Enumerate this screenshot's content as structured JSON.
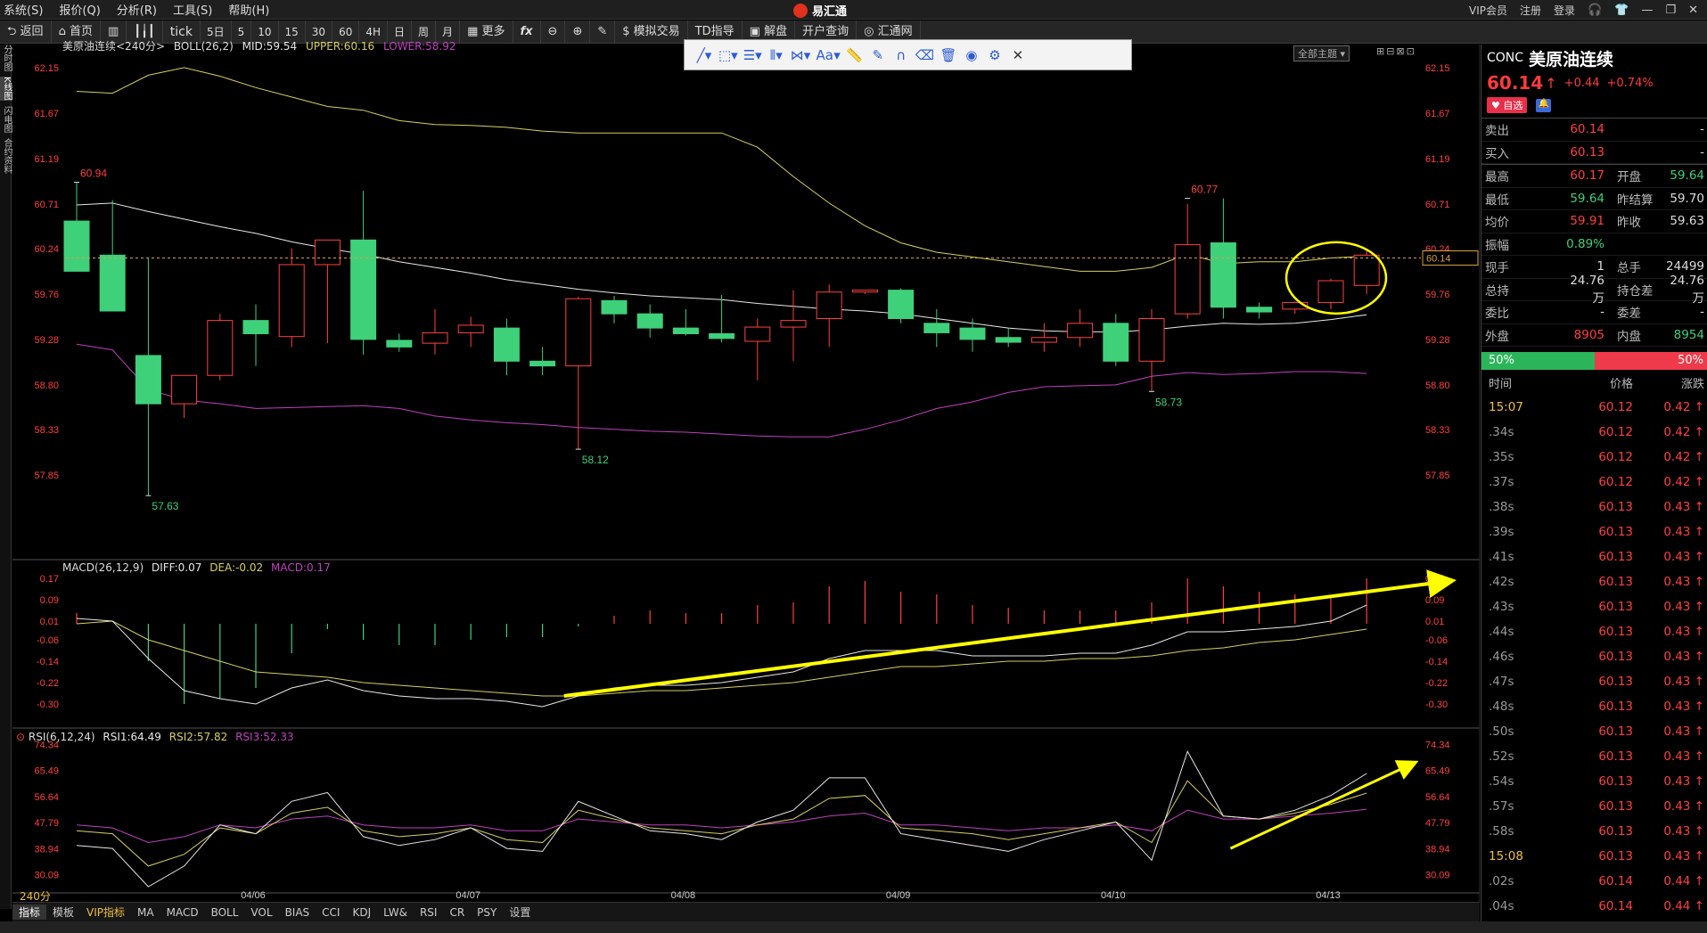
{
  "menu": [
    "系统(S)",
    "报价(Q)",
    "分析(R)",
    "工具(S)",
    "帮助(H)"
  ],
  "app_title": "易汇通",
  "topright": [
    "VIP会员",
    "注册",
    "登录"
  ],
  "toolbar": [
    "返回",
    "首页",
    "tick",
    "5日",
    "5",
    "10",
    "15",
    "30",
    "60",
    "4H",
    "日",
    "周",
    "月",
    "更多",
    "fx",
    "模拟交易",
    "TD指导",
    "解盘",
    "开户查询",
    "汇通网"
  ],
  "drawbar_icons": [
    "line-tool-icon",
    "rect-tool-icon",
    "channel-tool-icon",
    "fib-tool-icon",
    "pattern-tool-icon",
    "text-tool-icon",
    "ruler-icon",
    "pen-icon",
    "magnet-icon",
    "eraser-icon",
    "trash-icon",
    "eye-icon",
    "gear-icon",
    "close-icon"
  ],
  "drawbar_text": "Aa",
  "side_tabs": [
    "分时图",
    "K线图",
    "闪电图",
    "合约资料"
  ],
  "theme_button": "全部主题",
  "chart_data": [
    {
      "type": "candlestick",
      "title": "美原油连续<240分>",
      "indicator": "BOLL(26,2)",
      "legend": {
        "mid": "MID:59.54",
        "upper": "UPPER:60.16",
        "lower": "LOWER:58.92"
      },
      "ylim": [
        57.5,
        62.3
      ],
      "yticks": [
        "62.15",
        "61.67",
        "61.19",
        "60.71",
        "60.24",
        "59.76",
        "59.28",
        "58.80",
        "58.33",
        "57.85"
      ],
      "x_labels": [
        {
          "at": 5,
          "label": "04/06"
        },
        {
          "at": 11,
          "label": "04/07"
        },
        {
          "at": 17,
          "label": "04/08"
        },
        {
          "at": 23,
          "label": "04/09"
        },
        {
          "at": 29,
          "label": "04/10"
        },
        {
          "at": 35,
          "label": "04/13"
        }
      ],
      "candles": [
        [
          60.53,
          60.94,
          60.14,
          60.0
        ],
        [
          60.17,
          60.75,
          60.08,
          59.58
        ],
        [
          59.11,
          60.14,
          57.63,
          58.6
        ],
        [
          58.6,
          58.75,
          58.45,
          58.9
        ],
        [
          58.9,
          59.55,
          58.85,
          59.48
        ],
        [
          59.48,
          59.65,
          59.0,
          59.34
        ],
        [
          59.31,
          60.24,
          59.2,
          60.07
        ],
        [
          60.07,
          60.32,
          59.24,
          60.33
        ],
        [
          60.33,
          60.85,
          59.12,
          59.28
        ],
        [
          59.27,
          59.34,
          59.15,
          59.2
        ],
        [
          59.24,
          59.6,
          59.12,
          59.35
        ],
        [
          59.35,
          59.52,
          59.2,
          59.43
        ],
        [
          59.4,
          59.5,
          58.9,
          59.05
        ],
        [
          59.05,
          59.2,
          58.9,
          59.0
        ],
        [
          59.0,
          59.73,
          58.12,
          59.71
        ],
        [
          59.69,
          59.74,
          59.45,
          59.55
        ],
        [
          59.55,
          59.65,
          59.3,
          59.4
        ],
        [
          59.4,
          59.6,
          59.32,
          59.34
        ],
        [
          59.34,
          59.75,
          59.25,
          59.29
        ],
        [
          59.26,
          59.5,
          58.85,
          59.41
        ],
        [
          59.41,
          59.8,
          59.05,
          59.48
        ],
        [
          59.5,
          59.86,
          59.2,
          59.78
        ],
        [
          59.78,
          59.8,
          59.76,
          59.8
        ],
        [
          59.8,
          59.82,
          59.45,
          59.5
        ],
        [
          59.45,
          59.6,
          59.2,
          59.35
        ],
        [
          59.4,
          59.5,
          59.15,
          59.28
        ],
        [
          59.3,
          59.4,
          59.2,
          59.25
        ],
        [
          59.25,
          59.45,
          59.15,
          59.3
        ],
        [
          59.3,
          59.6,
          59.2,
          59.45
        ],
        [
          59.45,
          59.55,
          59.0,
          59.05
        ],
        [
          59.05,
          59.6,
          58.73,
          59.5
        ],
        [
          59.55,
          60.71,
          59.5,
          60.28
        ],
        [
          60.3,
          60.77,
          59.5,
          59.62
        ],
        [
          59.62,
          59.67,
          59.5,
          59.57
        ],
        [
          59.6,
          59.68,
          59.55,
          59.67
        ],
        [
          59.67,
          59.92,
          59.6,
          59.9
        ],
        [
          59.85,
          60.24,
          59.76,
          60.17
        ]
      ],
      "mid": [
        60.7,
        60.72,
        60.63,
        60.55,
        60.47,
        60.4,
        60.31,
        60.24,
        60.18,
        60.1,
        60.04,
        59.98,
        59.91,
        59.86,
        59.81,
        59.77,
        59.74,
        59.72,
        59.7,
        59.66,
        59.63,
        59.6,
        59.58,
        59.55,
        59.5,
        59.45,
        59.4,
        59.37,
        59.36,
        59.36,
        59.38,
        59.42,
        59.45,
        59.44,
        59.45,
        59.49,
        59.54
      ],
      "upper": [
        61.9,
        61.88,
        62.07,
        62.15,
        62.06,
        61.94,
        61.84,
        61.74,
        61.7,
        61.59,
        61.55,
        61.54,
        61.52,
        61.48,
        61.46,
        61.46,
        61.46,
        61.46,
        61.46,
        61.31,
        61.0,
        60.72,
        60.48,
        60.3,
        60.2,
        60.15,
        60.1,
        60.05,
        60.0,
        60.0,
        60.04,
        60.18,
        60.08,
        60.1,
        60.1,
        60.14,
        60.16
      ],
      "lower": [
        59.23,
        59.17,
        58.75,
        58.64,
        58.6,
        58.55,
        58.56,
        58.57,
        58.58,
        58.55,
        58.47,
        58.43,
        58.4,
        58.38,
        58.35,
        58.33,
        58.31,
        58.3,
        58.28,
        58.26,
        58.25,
        58.25,
        58.33,
        58.43,
        58.55,
        58.62,
        58.72,
        58.78,
        58.79,
        58.8,
        58.89,
        58.93,
        58.91,
        58.92,
        58.94,
        58.94,
        58.92
      ],
      "annotations": [
        {
          "at": 0,
          "value": 60.94,
          "label": "60.94",
          "dir": "up"
        },
        {
          "at": 2,
          "value": 57.63,
          "label": "57.63",
          "dir": "down"
        },
        {
          "at": 14,
          "value": 58.12,
          "label": "58.12",
          "dir": "down"
        },
        {
          "at": 31,
          "value": 60.77,
          "label": "60.77",
          "dir": "up"
        },
        {
          "at": 30,
          "value": 58.73,
          "label": "58.73",
          "dir": "down"
        }
      ],
      "last_price_label": "60.14",
      "last_price": 60.14
    },
    {
      "type": "line",
      "title": "MACD(26,12,9)",
      "legend": {
        "diff": "DIFF:0.07",
        "dea": "DEA:-0.02",
        "macd": "MACD:0.17"
      },
      "ylim": [
        -0.35,
        0.2
      ],
      "yticks": [
        "0.17",
        "0.09",
        "0.01",
        "-0.06",
        "-0.14",
        "-0.22",
        "-0.30"
      ],
      "diff": [
        0.02,
        0.01,
        -0.13,
        -0.25,
        -0.28,
        -0.3,
        -0.24,
        -0.21,
        -0.25,
        -0.27,
        -0.28,
        -0.28,
        -0.29,
        -0.31,
        -0.27,
        -0.24,
        -0.23,
        -0.23,
        -0.22,
        -0.2,
        -0.18,
        -0.13,
        -0.1,
        -0.1,
        -0.1,
        -0.12,
        -0.12,
        -0.12,
        -0.11,
        -0.11,
        -0.08,
        -0.03,
        -0.03,
        -0.02,
        -0.01,
        0.01,
        0.07
      ],
      "dea": [
        0.0,
        0.01,
        -0.06,
        -0.1,
        -0.14,
        -0.18,
        -0.19,
        -0.2,
        -0.22,
        -0.23,
        -0.24,
        -0.25,
        -0.26,
        -0.27,
        -0.27,
        -0.26,
        -0.25,
        -0.25,
        -0.24,
        -0.23,
        -0.22,
        -0.2,
        -0.18,
        -0.16,
        -0.16,
        -0.15,
        -0.14,
        -0.14,
        -0.13,
        -0.13,
        -0.12,
        -0.1,
        -0.09,
        -0.07,
        -0.06,
        -0.04,
        -0.02
      ],
      "hist": [
        0.04,
        0.0,
        -0.14,
        -0.3,
        -0.28,
        -0.24,
        -0.11,
        -0.02,
        -0.06,
        -0.08,
        -0.08,
        -0.06,
        -0.05,
        -0.05,
        -0.01,
        0.03,
        0.05,
        0.04,
        0.04,
        0.07,
        0.08,
        0.14,
        0.16,
        0.12,
        0.11,
        0.07,
        0.06,
        0.05,
        0.05,
        0.05,
        0.08,
        0.17,
        0.14,
        0.12,
        0.11,
        0.1,
        0.17
      ]
    },
    {
      "type": "line",
      "title": "RSI(6,12,24)",
      "legend": {
        "rsi1": "RSI1:64.49",
        "rsi2": "RSI2:57.82",
        "rsi3": "RSI3:52.33"
      },
      "ylim": [
        26,
        76
      ],
      "yticks": [
        "74.34",
        "65.49",
        "56.64",
        "47.79",
        "38.94",
        "30.09"
      ],
      "rsi1": [
        40,
        39,
        26,
        33,
        47,
        44,
        55,
        58,
        43,
        40,
        42,
        46,
        39,
        38,
        55,
        50,
        45,
        44,
        42,
        48,
        52,
        63,
        63,
        44,
        42,
        40,
        38,
        42,
        45,
        48,
        35,
        72,
        50,
        49,
        52,
        57,
        64.49
      ],
      "rsi2": [
        45,
        44,
        33,
        37,
        46,
        44,
        51,
        53,
        45,
        43,
        44,
        46,
        42,
        41,
        52,
        49,
        46,
        45,
        44,
        47,
        49,
        56,
        57,
        46,
        45,
        44,
        42,
        44,
        46,
        48,
        41,
        62,
        50,
        49,
        51,
        54,
        57.82
      ],
      "rsi3": [
        47,
        46,
        41,
        43,
        47,
        46,
        49,
        50,
        47,
        46,
        46,
        47,
        45,
        45,
        49,
        48,
        47,
        47,
        46,
        47,
        48,
        50,
        51,
        47,
        47,
        46,
        45,
        46,
        46,
        47,
        45,
        52,
        49,
        49,
        50,
        51,
        52.33
      ]
    }
  ],
  "period_label": "240分",
  "bottom_tabs": [
    "指标",
    "模板",
    "VIP指标",
    "MA",
    "MACD",
    "BOLL",
    "VOL",
    "BIAS",
    "CCI",
    "KDJ",
    "LW&",
    "RSI",
    "CR",
    "PSY",
    "设置"
  ],
  "quote": {
    "code": "CONC",
    "name": "美原油连续",
    "price": "60.14",
    "arrow": "↑",
    "change": "+0.44",
    "change_pct": "+0.74%",
    "fav_label": "自选",
    "sell_label": "卖出",
    "sell_price": "60.14",
    "sell_vol": "-",
    "buy_label": "买入",
    "buy_price": "60.13",
    "buy_vol": "-",
    "rows": [
      {
        "l1": "最高",
        "v1": "60.17",
        "c1": "red",
        "l2": "开盘",
        "v2": "59.64",
        "c2": "green"
      },
      {
        "l1": "最低",
        "v1": "59.64",
        "c1": "green",
        "l2": "昨结算",
        "v2": "59.70",
        "c2": "white"
      },
      {
        "l1": "均价",
        "v1": "59.91",
        "c1": "red",
        "l2": "昨收",
        "v2": "59.63",
        "c2": "white"
      },
      {
        "l1": "振幅",
        "v1": "0.89%",
        "c1": "green",
        "l2": "",
        "v2": "",
        "c2": "white"
      },
      {
        "l1": "现手",
        "v1": "1",
        "c1": "white",
        "l2": "总手",
        "v2": "24499",
        "c2": "white"
      },
      {
        "l1": "总持",
        "v1": "24.76万",
        "c1": "white",
        "l2": "持仓差",
        "v2": "24.76万",
        "c2": "white"
      },
      {
        "l1": "委比",
        "v1": "-",
        "c1": "white",
        "l2": "委差",
        "v2": "-",
        "c2": "white"
      },
      {
        "l1": "外盘",
        "v1": "8905",
        "c1": "red",
        "l2": "内盘",
        "v2": "8954",
        "c2": "green"
      }
    ],
    "buy_ratio": "50%",
    "sell_ratio": "50%",
    "tick_headers": [
      "时间",
      "价格",
      "涨跌"
    ],
    "ticks": [
      {
        "t": "15:07",
        "full": true,
        "p": "60.12",
        "c": "0.42"
      },
      {
        "t": ".34s",
        "p": "60.12",
        "c": "0.42"
      },
      {
        "t": ".35s",
        "p": "60.12",
        "c": "0.42"
      },
      {
        "t": ".37s",
        "p": "60.12",
        "c": "0.42"
      },
      {
        "t": ".38s",
        "p": "60.13",
        "c": "0.43"
      },
      {
        "t": ".39s",
        "p": "60.13",
        "c": "0.43"
      },
      {
        "t": ".41s",
        "p": "60.13",
        "c": "0.43"
      },
      {
        "t": ".42s",
        "p": "60.13",
        "c": "0.43"
      },
      {
        "t": ".43s",
        "p": "60.13",
        "c": "0.43"
      },
      {
        "t": ".44s",
        "p": "60.13",
        "c": "0.43"
      },
      {
        "t": ".46s",
        "p": "60.13",
        "c": "0.43"
      },
      {
        "t": ".47s",
        "p": "60.13",
        "c": "0.43"
      },
      {
        "t": ".48s",
        "p": "60.13",
        "c": "0.43"
      },
      {
        "t": ".50s",
        "p": "60.13",
        "c": "0.43"
      },
      {
        "t": ".52s",
        "p": "60.13",
        "c": "0.43"
      },
      {
        "t": ".54s",
        "p": "60.13",
        "c": "0.43"
      },
      {
        "t": ".57s",
        "p": "60.13",
        "c": "0.43"
      },
      {
        "t": ".58s",
        "p": "60.13",
        "c": "0.43"
      },
      {
        "t": "15:08",
        "full": true,
        "p": "60.13",
        "c": "0.43"
      },
      {
        "t": ".02s",
        "p": "60.14",
        "c": "0.44"
      },
      {
        "t": ".04s",
        "p": "60.14",
        "c": "0.44"
      }
    ]
  },
  "colors": {
    "up": "#ff4040",
    "down": "#3fd07a",
    "mid": "#e8e8e8",
    "upper": "#d8d060",
    "lower": "#c040c0",
    "highlight": "#ffff00"
  }
}
